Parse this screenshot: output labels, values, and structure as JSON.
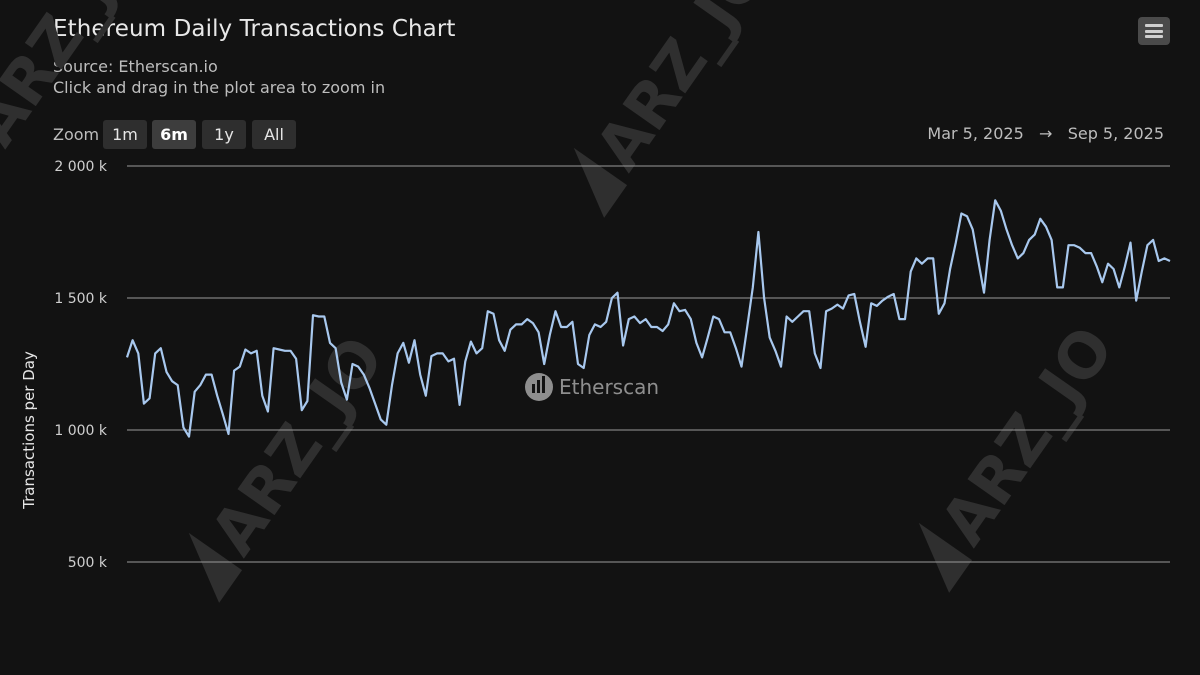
{
  "header": {
    "title": "Ethereum Daily Transactions Chart",
    "source": "Source: Etherscan.io",
    "hint": "Click and drag in the plot area to zoom in"
  },
  "zoom": {
    "label": "Zoom",
    "buttons": [
      "1m",
      "6m",
      "1y",
      "All"
    ],
    "active": "6m"
  },
  "range": {
    "from": "Mar 5, 2025",
    "arrow": "→",
    "to": "Sep 5, 2025"
  },
  "menu": {
    "icon": "hamburger-menu-icon"
  },
  "watermark": {
    "text": "ARZ_JO",
    "brand": "Etherscan"
  },
  "colors": {
    "line": "#a8c8ee",
    "background": "#121212",
    "grid": "#9a9a9a"
  },
  "chart_data": {
    "type": "line",
    "title": "Ethereum Daily Transactions Chart",
    "ylabel": "Transactions per Day",
    "yunit": "k",
    "ylim": [
      500,
      2000
    ],
    "yticks": [
      500,
      1000,
      1500,
      2000
    ],
    "ytick_labels": [
      "500 k",
      "1 000 k",
      "1 500 k",
      "2 000 k"
    ],
    "x_start": "Mar 5, 2025",
    "x_end": "Sep 5, 2025",
    "grid": true,
    "series": [
      {
        "values": [
          1275,
          1340,
          1290,
          1100,
          1120,
          1290,
          1310,
          1220,
          1185,
          1170,
          1010,
          975,
          1145,
          1170,
          1210,
          1210,
          1130,
          1060,
          985,
          1225,
          1240,
          1305,
          1290,
          1300,
          1130,
          1070,
          1310,
          1305,
          1300,
          1300,
          1270,
          1075,
          1110,
          1435,
          1430,
          1430,
          1330,
          1310,
          1180,
          1115,
          1250,
          1240,
          1210,
          1160,
          1100,
          1040,
          1020,
          1170,
          1290,
          1330,
          1255,
          1340,
          1210,
          1130,
          1280,
          1290,
          1290,
          1260,
          1270,
          1095,
          1260,
          1335,
          1290,
          1310,
          1450,
          1440,
          1340,
          1300,
          1380,
          1400,
          1400,
          1420,
          1405,
          1370,
          1250,
          1360,
          1450,
          1390,
          1390,
          1410,
          1250,
          1235,
          1360,
          1400,
          1390,
          1410,
          1500,
          1520,
          1320,
          1420,
          1430,
          1405,
          1420,
          1390,
          1390,
          1375,
          1400,
          1480,
          1450,
          1455,
          1420,
          1330,
          1275,
          1350,
          1430,
          1420,
          1370,
          1370,
          1310,
          1240,
          1390,
          1540,
          1750,
          1500,
          1350,
          1300,
          1240,
          1430,
          1410,
          1430,
          1450,
          1450,
          1290,
          1235,
          1450,
          1460,
          1475,
          1460,
          1510,
          1515,
          1410,
          1315,
          1480,
          1470,
          1490,
          1505,
          1515,
          1420,
          1420,
          1600,
          1650,
          1630,
          1650,
          1650,
          1440,
          1480,
          1610,
          1710,
          1820,
          1810,
          1760,
          1640,
          1520,
          1720,
          1870,
          1830,
          1760,
          1700,
          1650,
          1670,
          1720,
          1740,
          1800,
          1770,
          1720,
          1540,
          1540,
          1700,
          1700,
          1690,
          1670,
          1670,
          1620,
          1560,
          1630,
          1610,
          1540,
          1620,
          1710,
          1490,
          1600,
          1700,
          1720,
          1640,
          1650,
          1640
        ]
      }
    ]
  }
}
